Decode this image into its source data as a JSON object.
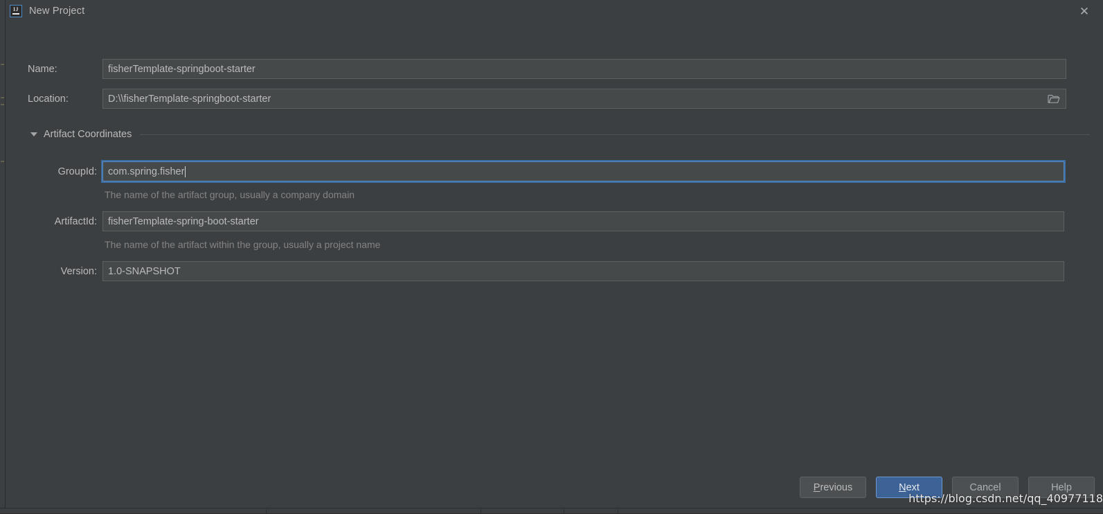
{
  "window": {
    "title": "New Project",
    "app_icon": "intellij-idea-logo-icon",
    "close_icon": "close-icon"
  },
  "form": {
    "name": {
      "label": "Name:",
      "value": "fisherTemplate-springboot-starter"
    },
    "location": {
      "label": "Location:",
      "value": "D:\\\\fisherTemplate-springboot-starter",
      "browse_icon": "folder-icon"
    }
  },
  "artifact_section": {
    "title": "Artifact Coordinates",
    "expanded": true,
    "toggle_icon": "chevron-down-icon",
    "fields": {
      "group_id": {
        "label": "GroupId:",
        "value": "com.spring.fisher",
        "hint": "The name of the artifact group, usually a company domain",
        "focused": true
      },
      "artifact_id": {
        "label": "ArtifactId:",
        "value": "fisherTemplate-spring-boot-starter",
        "hint": "The name of the artifact within the group, usually a project name",
        "focused": false
      },
      "version": {
        "label": "Version:",
        "value": "1.0-SNAPSHOT",
        "hint": "",
        "focused": false
      }
    }
  },
  "buttons": {
    "previous": {
      "label_pre": "",
      "label_mnemonic": "P",
      "label_post": "revious"
    },
    "next": {
      "label_pre": "",
      "label_mnemonic": "N",
      "label_post": "ext"
    },
    "cancel": {
      "label": "Cancel"
    },
    "help": {
      "label": "Help"
    }
  },
  "watermark": {
    "text": "https://blog.csdn.net/qq_40977118"
  },
  "colors": {
    "dialog_bg": "#3c3f41",
    "field_bg": "#45494a",
    "field_border": "#5e6060",
    "focus_blue": "#5a8ac4",
    "primary_button": "#3c6296",
    "text": "#bbbbbb",
    "hint_text": "#848484"
  }
}
